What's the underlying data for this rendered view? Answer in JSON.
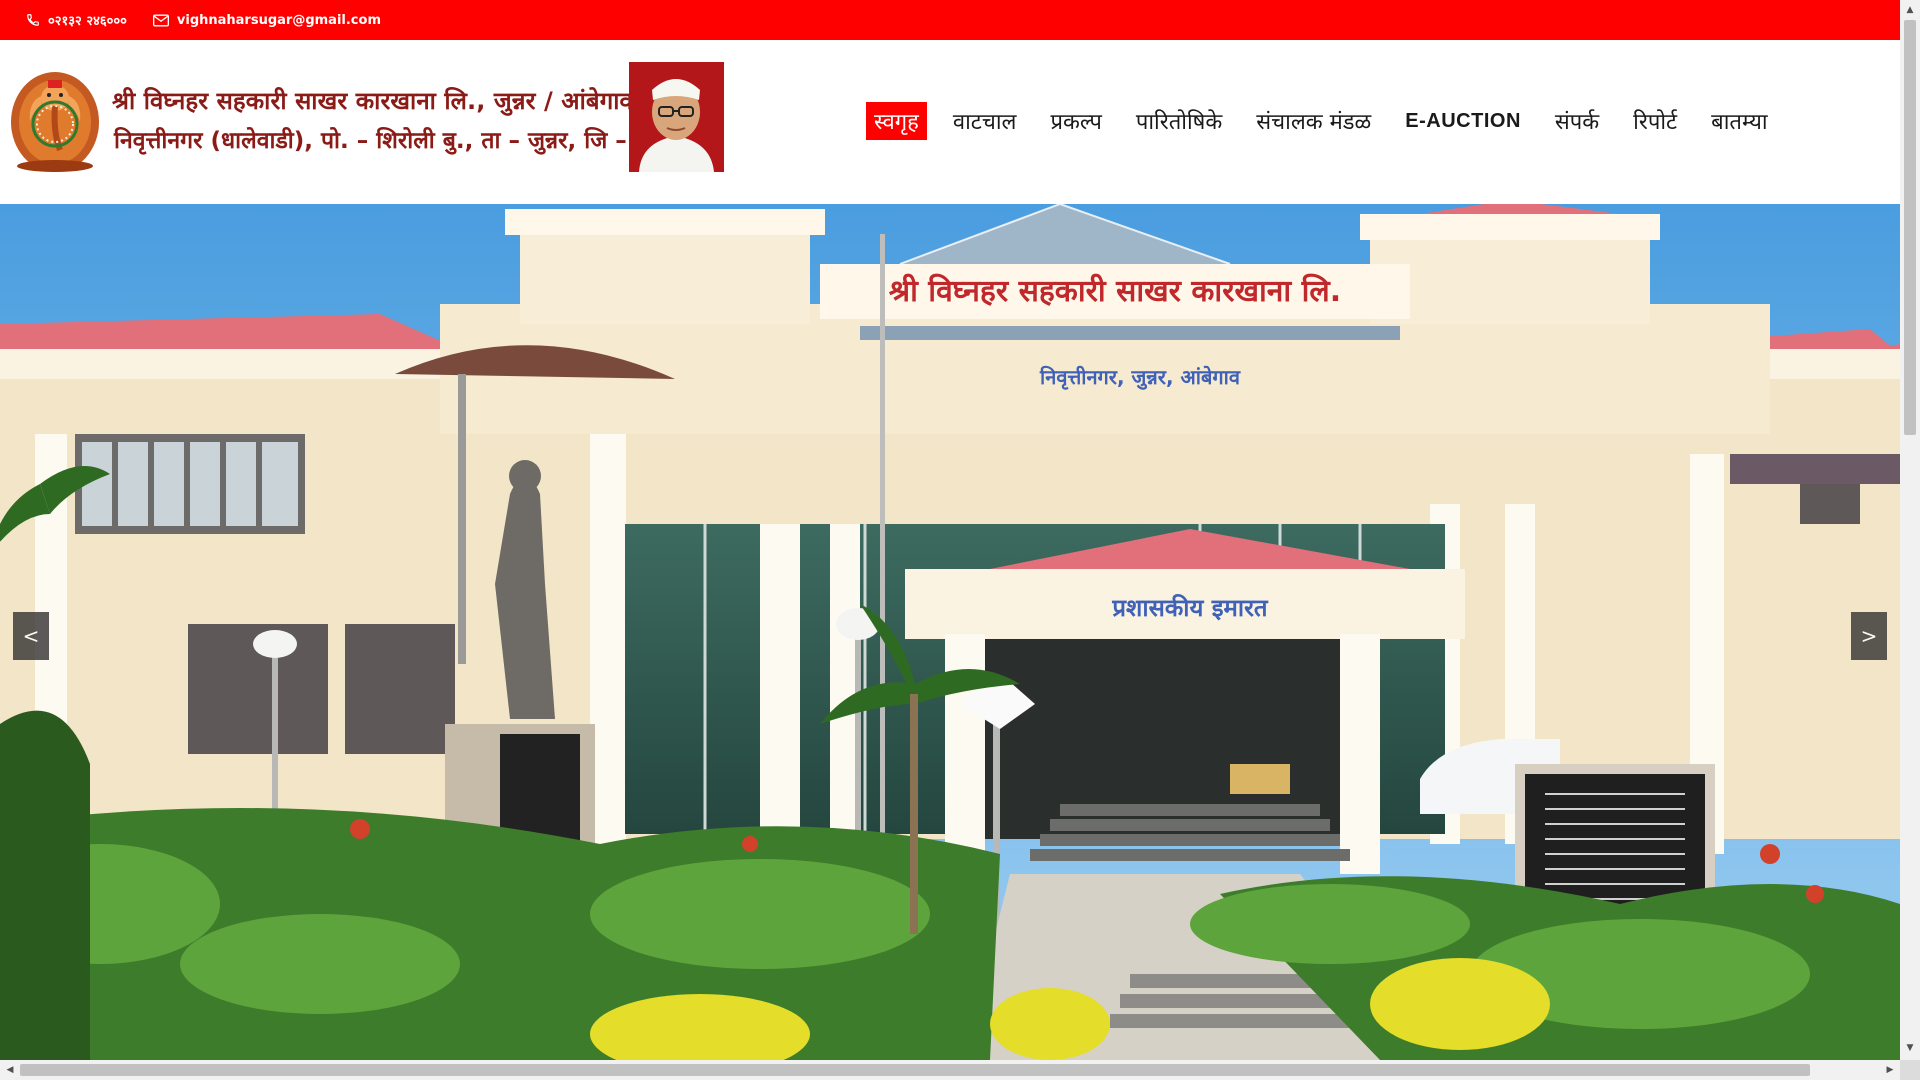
{
  "topbar": {
    "phone": "०२१३२ २४६०००",
    "email": "vighnaharsugar@gmail.com",
    "background": "#ff0000"
  },
  "header": {
    "title_line1": "श्री विघ्नहर सहकारी साखर कारखाना लि., जुन्नर / आंबेगाव",
    "title_line2": "निवृत्तीनगर (धालेवाडी), पो. – शिरोली बु., ता – जुन्नर, जि – पुणे",
    "title_color": "#8b1b16"
  },
  "nav": {
    "items": [
      {
        "label": "स्वगृह",
        "active": true
      },
      {
        "label": "वाटचाल",
        "active": false
      },
      {
        "label": "प्रकल्प",
        "active": false
      },
      {
        "label": "पारितोषिके",
        "active": false
      },
      {
        "label": "संचालक मंडळ",
        "active": false
      },
      {
        "label": "E-AUCTION",
        "active": false
      },
      {
        "label": "संपर्क",
        "active": false
      },
      {
        "label": "रिपोर्ट",
        "active": false
      },
      {
        "label": "बातम्या",
        "active": false
      }
    ],
    "active_color": "#ff0000"
  },
  "hero": {
    "building_sign": "श्री विघ्नहर सहकारी साखर कारखाना लि.",
    "building_subsign": "निवृत्तीनगर, जुन्नर, आंबेगाव",
    "admin_sign": "प्रशासकीय इमारत",
    "prev_label": "<",
    "next_label": ">"
  },
  "icons": {
    "phone": "phone-icon",
    "email": "mail-icon",
    "logo": "ganesh-logo",
    "portrait": "founder-portrait"
  }
}
